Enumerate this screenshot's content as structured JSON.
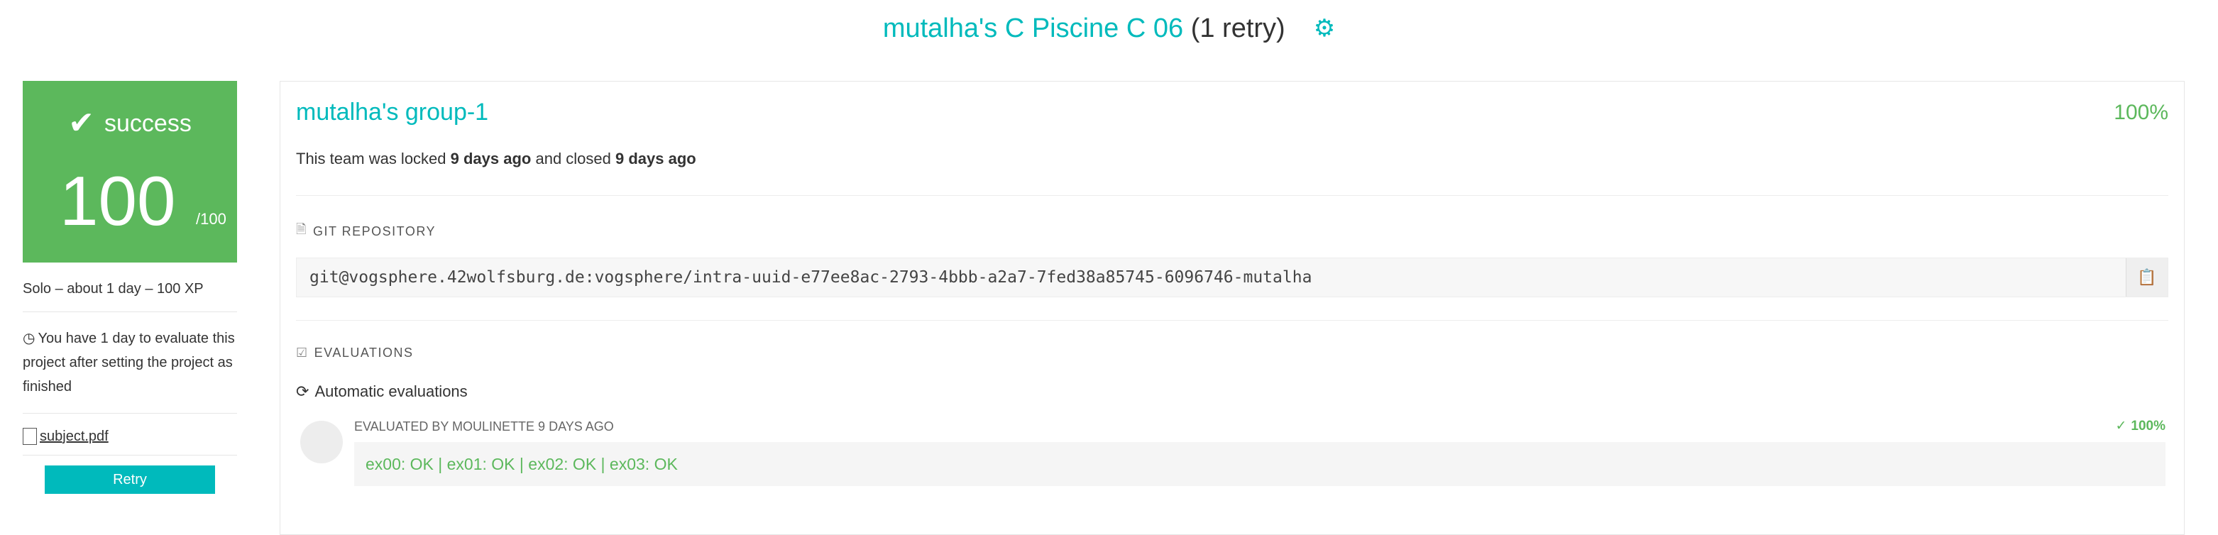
{
  "header": {
    "project": "mutalha's C Piscine C 06",
    "retry": "(1 retry)",
    "settings_icon": "gear-icon"
  },
  "sidebar": {
    "status": "success",
    "score": "100",
    "max_score": "/100",
    "meta": "Solo – about 1 day – 100 XP",
    "note": "You have 1 day to evaluate this project after setting the project as finished",
    "subject_link": "subject.pdf",
    "retry_button": "Retry"
  },
  "team": {
    "name": "mutalha's group-1",
    "percent": "100%",
    "locked_prefix": "This team was locked ",
    "locked_when": "9 days ago",
    "closed_mid": " and closed ",
    "closed_when": "9 days ago"
  },
  "git": {
    "label": "GIT REPOSITORY",
    "url": "git@vogsphere.42wolfsburg.de:vogsphere/intra-uuid-e77ee8ac-2793-4bbb-a2a7-7fed38a85745-6096746-mutalha"
  },
  "evaluations": {
    "label": "EVALUATIONS",
    "automatic_label": "Automatic evaluations",
    "items": [
      {
        "evaluated_by": "EVALUATED BY MOULINETTE 9 DAYS AGO",
        "percent": "100%",
        "result": "ex00: OK | ex01: OK | ex02: OK | ex03: OK"
      }
    ]
  },
  "colors": {
    "accent": "#00babc",
    "success": "#5cb85c"
  }
}
